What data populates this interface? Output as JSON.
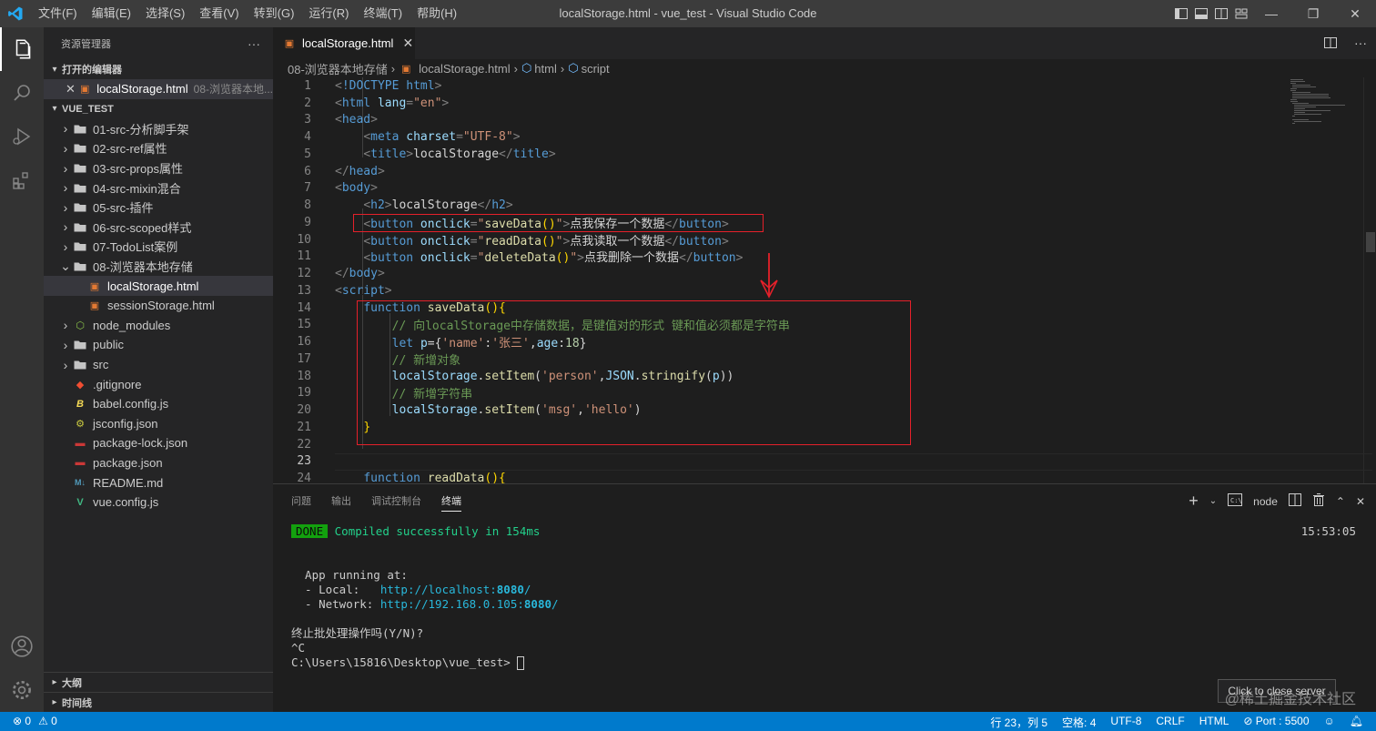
{
  "titlebar": {
    "menu": [
      "文件(F)",
      "编辑(E)",
      "选择(S)",
      "查看(V)",
      "转到(G)",
      "运行(R)",
      "终端(T)",
      "帮助(H)"
    ],
    "title": "localStorage.html - vue_test - Visual Studio Code"
  },
  "sidebar": {
    "header": "资源管理器",
    "open_editors_label": "打开的编辑器",
    "open_editor": {
      "name": "localStorage.html",
      "desc": "08-浏览器本地..."
    },
    "project_label": "VUE_TEST",
    "items": [
      {
        "label": "01-src-分析脚手架",
        "type": "folder"
      },
      {
        "label": "02-src-ref属性",
        "type": "folder"
      },
      {
        "label": "03-src-props属性",
        "type": "folder"
      },
      {
        "label": "04-src-mixin混合",
        "type": "folder"
      },
      {
        "label": "05-src-插件",
        "type": "folder"
      },
      {
        "label": "06-src-scoped样式",
        "type": "folder"
      },
      {
        "label": "07-TodoList案例",
        "type": "folder"
      },
      {
        "label": "08-浏览器本地存储",
        "type": "folder-open"
      },
      {
        "label": "localStorage.html",
        "type": "html"
      },
      {
        "label": "sessionStorage.html",
        "type": "html"
      },
      {
        "label": "node_modules",
        "type": "node"
      },
      {
        "label": "public",
        "type": "folder"
      },
      {
        "label": "src",
        "type": "folder"
      },
      {
        "label": ".gitignore",
        "type": "git"
      },
      {
        "label": "babel.config.js",
        "type": "babel"
      },
      {
        "label": "jsconfig.json",
        "type": "json-gear"
      },
      {
        "label": "package-lock.json",
        "type": "npm"
      },
      {
        "label": "package.json",
        "type": "npm"
      },
      {
        "label": "README.md",
        "type": "md"
      },
      {
        "label": "vue.config.js",
        "type": "vue"
      }
    ],
    "outline_label": "大纲",
    "timeline_label": "时间线"
  },
  "editor": {
    "tab_label": "localStorage.html",
    "breadcrumb": [
      "08-浏览器本地存储",
      "localStorage.html",
      "html",
      "script"
    ],
    "line_numbers": [
      "1",
      "2",
      "3",
      "4",
      "5",
      "6",
      "7",
      "8",
      "9",
      "10",
      "11",
      "12",
      "13",
      "14",
      "15",
      "16",
      "17",
      "18",
      "19",
      "20",
      "21",
      "22",
      "23",
      "24"
    ],
    "code_lines": [
      "<!DOCTYPE html>",
      "<html lang=\"en\">",
      "<head>",
      "    <meta charset=\"UTF-8\">",
      "    <title>localStorage</title>",
      "</head>",
      "<body>",
      "    <h2>localStorage</h2>",
      "    <button onclick=\"saveData()\">点我保存一个数据</button>",
      "    <button onclick=\"readData()\">点我读取一个数据</button>",
      "    <button onclick=\"deleteData()\">点我删除一个数据</button>",
      "</body>",
      "<script>",
      "    function saveData(){",
      "        // 向localStorage中存储数据，是键值对的形式 键和值必须都是字符串",
      "        let p={'name':'张三',age:18}",
      "        // 新增对象",
      "        localStorage.setItem('person',JSON.stringify(p))",
      "        // 新增字符串",
      "        localStorage.setItem('msg','hello')",
      "    }",
      "",
      "",
      "    function readData(){"
    ]
  },
  "panel": {
    "tabs": [
      "问题",
      "输出",
      "调试控制台",
      "终端"
    ],
    "active_tab": "终端",
    "terminal_name": "node",
    "time": "15:53:05",
    "done_badge": "DONE",
    "compiled": "Compiled successfully in 154ms",
    "app_running": "  App running at:",
    "local_label": "  - Local:   ",
    "local_url_pre": "http://localhost:",
    "local_port": "8080",
    "network_label": "  - Network: ",
    "network_url_pre": "http://192.168.0.105:",
    "network_port": "8080",
    "slash": "/",
    "terminate": "终止批处理操作吗(Y/N)?",
    "ctrl_c": "^C",
    "prompt": "C:\\Users\\15816\\Desktop\\vue_test> ",
    "tooltip": "Click to close server",
    "watermark": "@稀土掘金技术社区"
  },
  "statusbar": {
    "errors": "⊗ 0",
    "warnings": "⚠ 0",
    "position": "行 23，列 5",
    "spaces": "空格: 4",
    "encoding": "UTF-8",
    "eol": "CRLF",
    "language": "HTML",
    "port": "⊘ Port : 5500"
  },
  "colors": {
    "accent": "#007acc",
    "annotation": "#e5202a"
  }
}
